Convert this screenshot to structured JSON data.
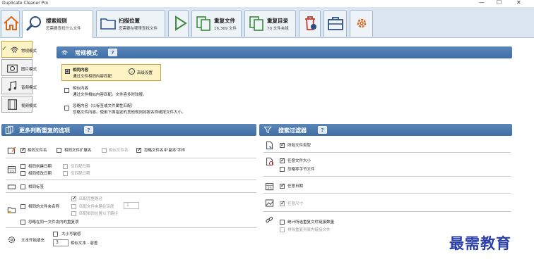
{
  "window": {
    "title": "Duplicate Cleaner Pro",
    "min": "—",
    "max": "☐",
    "close": "✕"
  },
  "toolbar": {
    "home_label": "",
    "tabs": [
      {
        "title": "搜索规则",
        "subtitle": "您需要查找什么文件"
      },
      {
        "title": "扫描位置",
        "subtitle": "您需要在哪里查找文件"
      },
      {
        "title": "",
        "subtitle": ""
      },
      {
        "title": "重复文件",
        "subtitle": "16,369 文件"
      },
      {
        "title": "重复目录",
        "subtitle": "70 文件夹组"
      }
    ]
  },
  "sidebar": {
    "items": [
      {
        "label": "常规模式",
        "icon": "fingerprint-icon"
      },
      {
        "label": "图片模式",
        "icon": "camera-icon"
      },
      {
        "label": "音频模式",
        "icon": "music-note-icon"
      },
      {
        "label": "视频模式",
        "icon": "film-icon"
      }
    ]
  },
  "mode_section": {
    "header": "常规模式",
    "help": "?",
    "options": [
      {
        "title": "相同内容",
        "desc": "通过文件相同内容匹配"
      },
      {
        "title": "相似内容",
        "desc": "通过文件相似内容匹配。文件容多时较慢。"
      },
      {
        "title": "忽略内容（以标签或文件属性匹配）",
        "desc": "忽略文件内容。使用下面指定的其他规则如按名称或按文件大小。"
      }
    ],
    "advanced_label": "高级设置"
  },
  "more_options": {
    "header": "更多判断重复的选项",
    "help": "?",
    "row1": [
      "相同文件名",
      "相同文件扩展名",
      "相似文件名",
      "忽略文件名中'副本'字样"
    ],
    "row2a": [
      "相同创建日期",
      "仅匹配日期"
    ],
    "row2b": [
      "相同修改日期",
      "仅匹配日期"
    ],
    "row3": "相同标签",
    "row4": {
      "main": "相同的文件夹名称",
      "opt1": "匹配完整路径",
      "opt2": "匹配文件夹路径深度",
      "depth": "1",
      "opt3": "匹配相同位置以下路径"
    },
    "row5": "忽略在同一文件夹内的重复项",
    "row6": {
      "label": "文本开始填充",
      "opt1": "大小写敏感",
      "num": "3",
      "opt2": "相似文本 - 容差"
    }
  },
  "filters": {
    "header": "搜索过滤器",
    "help": "?",
    "items": [
      "所有文件类型",
      "任意文件大小",
      "忽略零字节文件",
      "任意日期",
      "任意尺寸",
      "统计所选重复文件链接数量",
      "排除重复列表内链接文件"
    ]
  },
  "watermark": "最需教育"
}
